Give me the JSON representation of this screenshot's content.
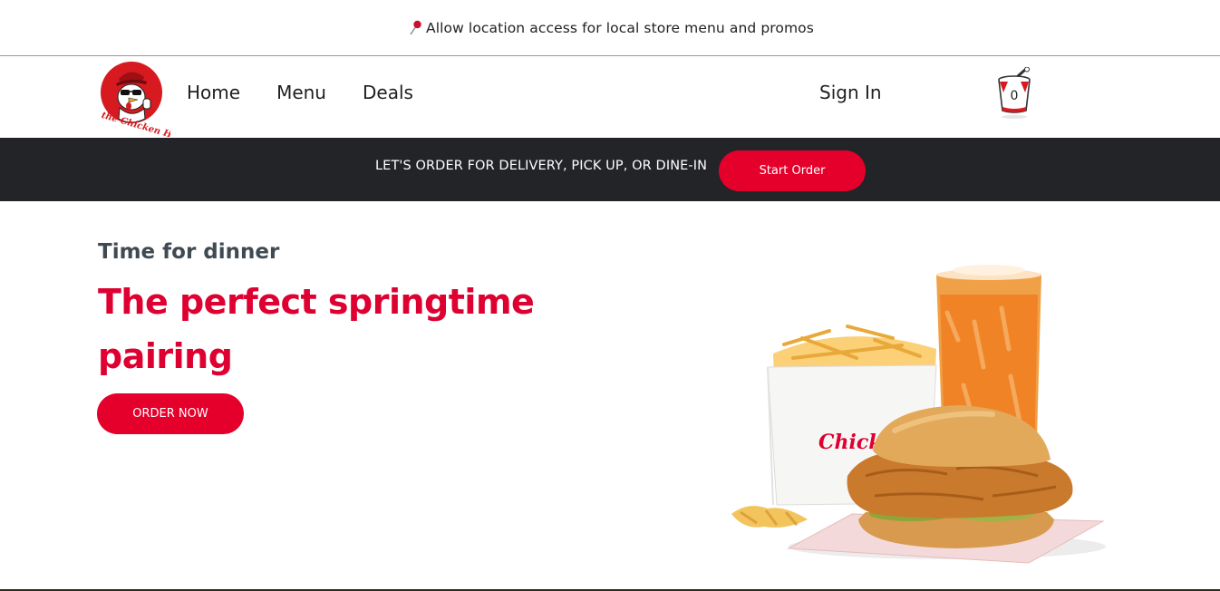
{
  "location_bar": {
    "icon": "map-pin-icon",
    "text": "Allow location access for local store menu and promos"
  },
  "header": {
    "logo_icon": "the-chicken-hub-logo",
    "logo_text": "the Chicken Hub",
    "nav": [
      {
        "label": "Home"
      },
      {
        "label": "Menu"
      },
      {
        "label": "Deals"
      }
    ],
    "sign_in": "Sign In",
    "cart": {
      "icon": "cart-bucket-icon",
      "count": "0"
    }
  },
  "order_banner": {
    "text": "LET'S ORDER FOR DELIVERY, PICK UP, OR DINE-IN",
    "button": "Start Order"
  },
  "hero": {
    "eyebrow": "Time for dinner",
    "title": "The perfect springtime pairing",
    "button": "ORDER NOW",
    "image_icon": "chicken-sandwich-fries-drink-image",
    "fries_box_brand": "Chick-fil-A"
  },
  "colors": {
    "brand_red": "#e4002b",
    "dark_banner": "#232428",
    "eyebrow_gray": "#3f4a52"
  }
}
